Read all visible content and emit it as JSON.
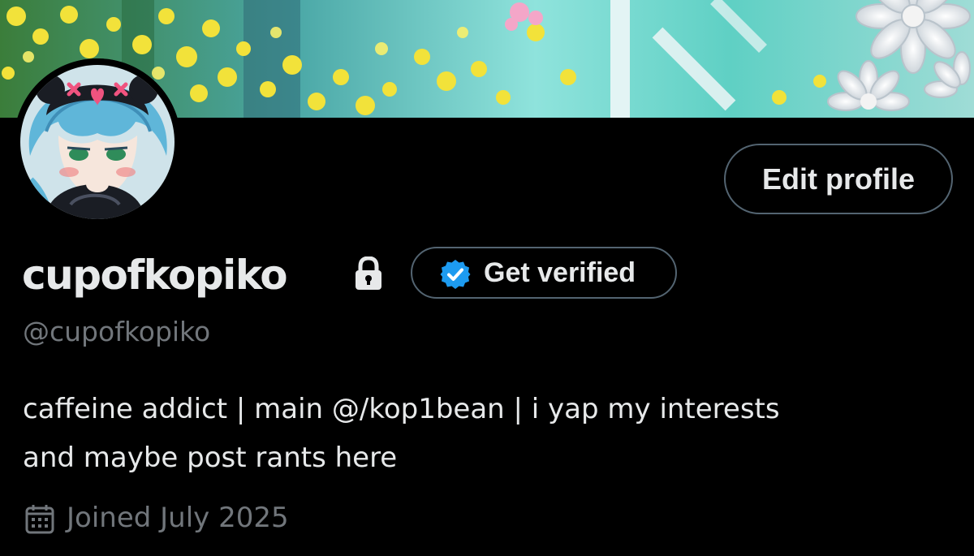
{
  "profile": {
    "display_name": "cupofkopiko",
    "handle": "@cupofkopiko",
    "bio_line_1": "caffeine addict | main @/kop1bean | i yap my interests",
    "bio_line_2": "and maybe post rants here",
    "joined": "Joined July 2025",
    "protected": true
  },
  "actions": {
    "edit_profile_label": "Edit profile",
    "get_verified_label": "Get verified"
  },
  "icons": {
    "lock": "lock-icon",
    "verified": "verified-badge-icon",
    "calendar": "calendar-icon"
  },
  "colors": {
    "background": "#000000",
    "primary_text": "#e7e9ea",
    "secondary_text": "#71767b",
    "border": "#536471",
    "verified_blue": "#1d9bf0"
  }
}
